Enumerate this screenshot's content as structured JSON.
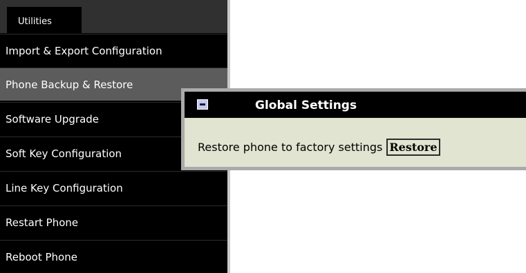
{
  "menu": {
    "tab_label": "Utilities",
    "items": [
      {
        "label": "Import & Export Configuration",
        "active": false
      },
      {
        "label": "Phone Backup & Restore",
        "active": true
      },
      {
        "label": "Software Upgrade",
        "active": false
      },
      {
        "label": "Soft Key Configuration",
        "active": false
      },
      {
        "label": "Line Key Configuration",
        "active": false
      },
      {
        "label": "Restart Phone",
        "active": false
      },
      {
        "label": "Reboot Phone",
        "active": false
      }
    ]
  },
  "panel": {
    "title": "Global Settings",
    "collapse_icon": "collapse-minus-icon",
    "restore_label": "Restore phone to factory settings",
    "restore_button_label": "Restore"
  },
  "colors": {
    "menu_background": "#000000",
    "menu_active_item": "#5c5c5c",
    "menu_header": "#303030",
    "panel_background": "#e0e4d0",
    "panel_title_bar": "#000000",
    "panel_border": "#aaaaaa"
  }
}
